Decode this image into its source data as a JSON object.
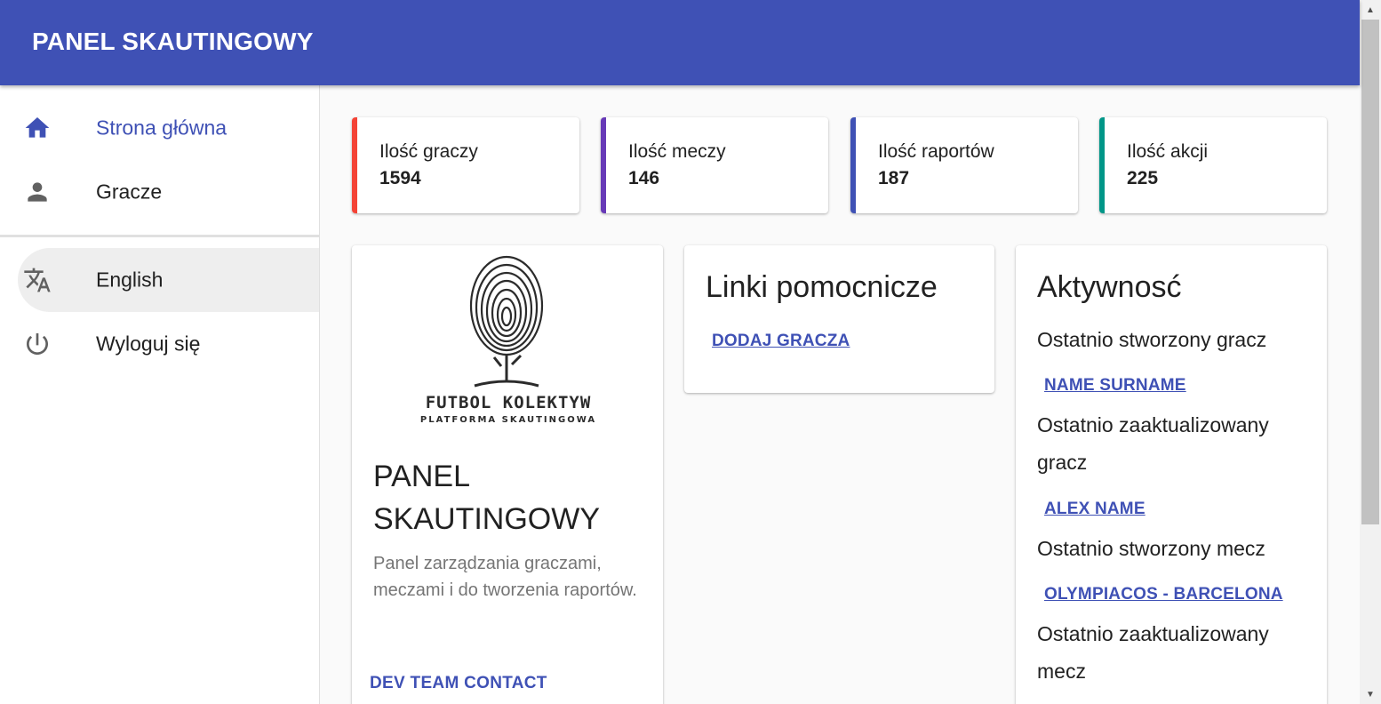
{
  "appbar": {
    "title": "PANEL SKAUTINGOWY",
    "color": "#3f51b5"
  },
  "sidebar": {
    "items": [
      {
        "label": "Strona główna",
        "icon": "home-icon",
        "active": true
      },
      {
        "label": "Gracze",
        "icon": "person-icon"
      },
      {
        "label": "English",
        "icon": "translate-icon"
      },
      {
        "label": "Wyloguj się",
        "icon": "power-icon"
      }
    ]
  },
  "stats": [
    {
      "label": "Ilość graczy",
      "value": "1594",
      "color": "#f44336"
    },
    {
      "label": "Ilość meczy",
      "value": "146",
      "color": "#673ab7"
    },
    {
      "label": "Ilość raportów",
      "value": "187",
      "color": "#3f51b5"
    },
    {
      "label": "Ilość akcji",
      "value": "225",
      "color": "#009688"
    }
  ],
  "brand_card": {
    "logo_line1": "FUTBOL KOLEKTYW",
    "logo_line2": "PLATFORMA SKAUTINGOWA",
    "title": "PANEL SKAUTINGOWY",
    "description": "Panel zarządzania graczami, meczami i do tworzenia raportów.",
    "button": "DEV TEAM CONTACT"
  },
  "links_card": {
    "title": "Linki pomocnicze",
    "link": "DODAJ GRACZA"
  },
  "activity_card": {
    "title": "Aktywnosć",
    "items": [
      {
        "label": "Ostatnio stworzony gracz",
        "link": "NAME SURNAME"
      },
      {
        "label": "Ostatnio zaaktualizowany gracz",
        "link": "ALEX NAME"
      },
      {
        "label": "Ostatnio stworzony mecz",
        "link": "OLYMPIACOS - BARCELONA"
      },
      {
        "label": "Ostatnio zaaktualizowany mecz"
      }
    ]
  }
}
